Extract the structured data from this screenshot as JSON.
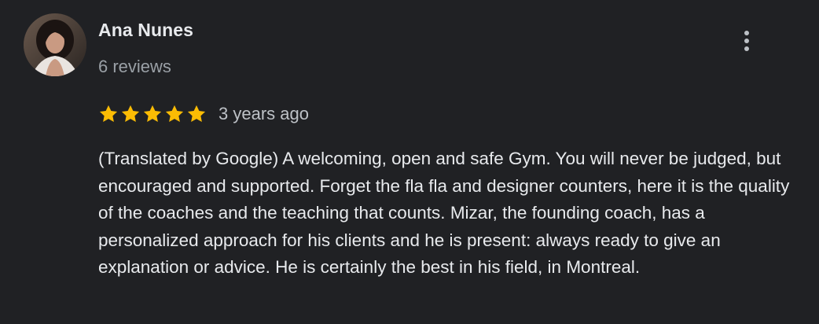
{
  "review": {
    "author_name": "Ana Nunes",
    "review_count": "6 reviews",
    "rating": 5,
    "rating_max": 5,
    "timestamp": "3 years ago",
    "text": "(Translated by Google) A welcoming, open and safe Gym. You will never be judged, but encouraged and supported. Forget the fla fla and designer counters, here it is the quality of the coaches and the teaching that counts. Mizar, the founding coach, has a personalized approach for his clients and he is present: always ready to give an explanation or advice. He is certainly the best in his field, in Montreal.",
    "more_options_icon": "more-vert-icon",
    "star_icon": "star-icon"
  },
  "colors": {
    "background": "#202124",
    "primary_text": "#e8eaed",
    "secondary_text": "#9aa0a6",
    "star": "#fbbc04"
  }
}
